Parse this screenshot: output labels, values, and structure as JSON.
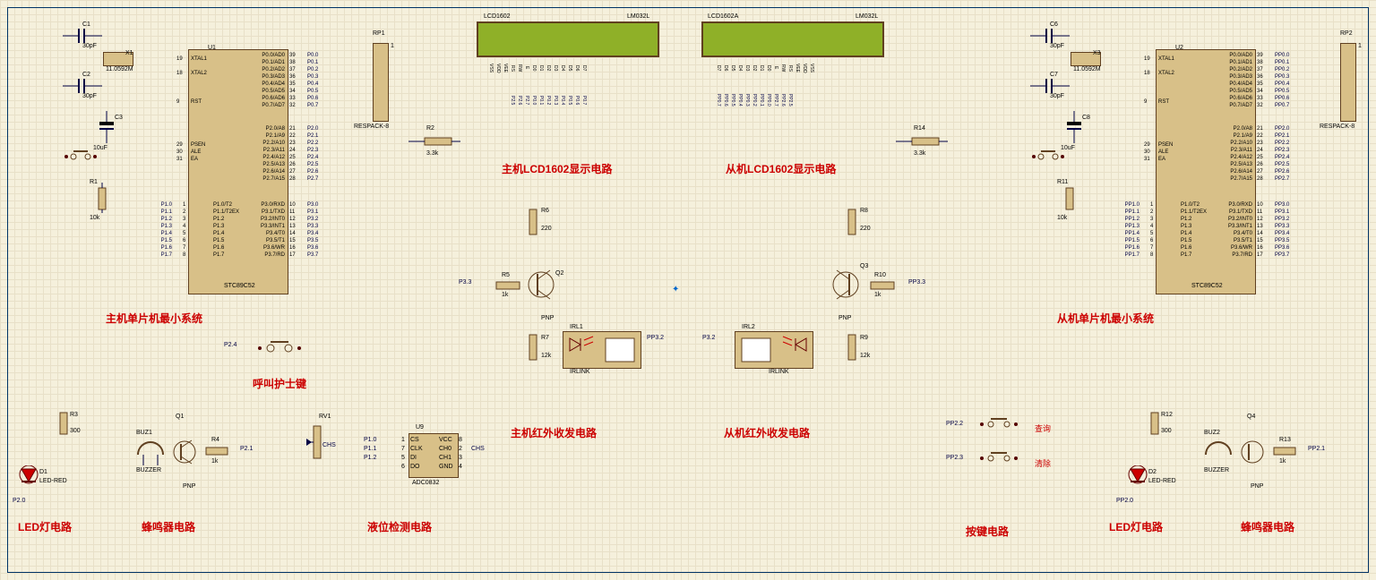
{
  "center_mark": "✦",
  "titles": {
    "master_mcu": "主机单片机最小系统",
    "slave_mcu": "从机单片机最小系统",
    "master_lcd": "主机LCD1602显示电路",
    "slave_lcd": "从机LCD1602显示电路",
    "master_ir": "主机红外收发电路",
    "slave_ir": "从机红外收发电路",
    "led_ckt_l": "LED灯电路",
    "buzzer_ckt_l": "蜂鸣器电路",
    "level_ckt": "液位检测电路",
    "nurse_key": "呼叫护士键",
    "key_ckt": "按键电路",
    "led_ckt_r": "LED灯电路",
    "buzzer_ckt_r": "蜂鸣器电路",
    "query": "查询",
    "clear": "清除"
  },
  "parts": {
    "U1": {
      "ref": "U1",
      "val": "STC89C52"
    },
    "U2": {
      "ref": "U2",
      "val": "STC89C52"
    },
    "U9": {
      "ref": "U9",
      "val": "ADC0832"
    },
    "X1": {
      "ref": "X1",
      "val": "11.0592M",
      "type": "CRYSTAL"
    },
    "X3": {
      "ref": "X3",
      "val": "11.0592M",
      "type": "CRYSTAL"
    },
    "C1": {
      "ref": "C1",
      "val": "30pF"
    },
    "C2": {
      "ref": "C2",
      "val": "30pF"
    },
    "C3": {
      "ref": "C3",
      "val": "10uF"
    },
    "C6": {
      "ref": "C6",
      "val": "30pF"
    },
    "C7": {
      "ref": "C7",
      "val": "30pF"
    },
    "C8": {
      "ref": "C8",
      "val": "10uF"
    },
    "R1": {
      "ref": "R1",
      "val": "10k"
    },
    "R2": {
      "ref": "R2",
      "val": "3.3k"
    },
    "R3": {
      "ref": "R3",
      "val": "300"
    },
    "R4": {
      "ref": "R4",
      "val": "1k"
    },
    "R5": {
      "ref": "R5",
      "val": "1k"
    },
    "R6": {
      "ref": "R6",
      "val": "220"
    },
    "R7": {
      "ref": "R7",
      "val": "12k"
    },
    "R8": {
      "ref": "R8",
      "val": "220"
    },
    "R9": {
      "ref": "R9",
      "val": "12k"
    },
    "R10": {
      "ref": "R10",
      "val": "1k"
    },
    "R11": {
      "ref": "R11",
      "val": "10k"
    },
    "R12": {
      "ref": "R12",
      "val": "300"
    },
    "R13": {
      "ref": "R13",
      "val": "1k"
    },
    "R14": {
      "ref": "R14",
      "val": "3.3k"
    },
    "RP1": {
      "ref": "RP1",
      "val": "RESPACK-8"
    },
    "RP2": {
      "ref": "RP2",
      "val": "RESPACK-8"
    },
    "RV1": {
      "ref": "RV1",
      "val": ""
    },
    "D1": {
      "ref": "D1",
      "val": "LED-RED"
    },
    "D2": {
      "ref": "D2",
      "val": "LED-RED"
    },
    "Q1": {
      "ref": "Q1",
      "val": "PNP"
    },
    "Q2": {
      "ref": "Q2",
      "val": "PNP"
    },
    "Q3": {
      "ref": "Q3",
      "val": "PNP"
    },
    "Q4": {
      "ref": "Q4",
      "val": "PNP"
    },
    "BUZ1": {
      "ref": "BUZ1",
      "val": "BUZZER"
    },
    "BUZ2": {
      "ref": "BUZ2",
      "val": "BUZZER"
    },
    "IRL1": {
      "ref": "IRL1",
      "val": "IRLINK"
    },
    "IRL2": {
      "ref": "IRL2",
      "val": "IRLINK"
    },
    "LCD1": {
      "ref": "LCD1602",
      "val": "LM032L"
    },
    "LCD2": {
      "ref": "LCD1602A",
      "val": "LM032L"
    }
  },
  "nets": {
    "P3_3": "P3.3",
    "PP3_3": "PP3.3",
    "PP3_2": "PP3.2",
    "P3_2": "P3.2",
    "P2_0": "P2.0",
    "P2_1": "P2.1",
    "P2_4": "P2.4",
    "P1_0": "P1.0",
    "P1_1": "P1.1",
    "P1_2": "P1.2",
    "PP2_0": "PP2.0",
    "PP2_1": "PP2.1",
    "PP2_2": "PP2.2",
    "PP2_3": "PP2.3"
  },
  "mcu_pins_left_upper": [
    "XTAL1",
    "XTAL2",
    "RST",
    "PSEN",
    "ALE",
    "EA"
  ],
  "mcu_pins_left_nums": [
    "19",
    "18",
    "9",
    "29",
    "30",
    "31"
  ],
  "mcu_pins_right_p0": [
    "P0.0/AD0",
    "P0.1/AD1",
    "P0.2/AD2",
    "P0.3/AD3",
    "P0.4/AD4",
    "P0.5/AD5",
    "P0.6/AD6",
    "P0.7/AD7"
  ],
  "mcu_pins_right_p0_nums": [
    "39",
    "38",
    "37",
    "36",
    "35",
    "34",
    "33",
    "32"
  ],
  "mcu_pins_right_p0_nets": [
    "P0.0",
    "P0.1",
    "P0.2",
    "P0.3",
    "P0.4",
    "P0.5",
    "P0.6",
    "P0.7"
  ],
  "mcu_pins_right_pp0_nets": [
    "PP0.0",
    "PP0.1",
    "PP0.2",
    "PP0.3",
    "PP0.4",
    "PP0.5",
    "PP0.6",
    "PP0.7"
  ],
  "mcu_pins_right_p2": [
    "P2.0/A8",
    "P2.1/A9",
    "P2.2/A10",
    "P2.3/A11",
    "P2.4/A12",
    "P2.5/A13",
    "P2.6/A14",
    "P2.7/A15"
  ],
  "mcu_pins_right_p2_nums": [
    "21",
    "22",
    "23",
    "24",
    "25",
    "26",
    "27",
    "28"
  ],
  "mcu_pins_right_p2_nets": [
    "P2.0",
    "P2.1",
    "P2.2",
    "P2.3",
    "P2.4",
    "P2.5",
    "P2.6",
    "P2.7"
  ],
  "mcu_pins_right_pp2_nets": [
    "PP2.0",
    "PP2.1",
    "PP2.2",
    "PP2.3",
    "PP2.4",
    "PP2.5",
    "PP2.6",
    "PP2.7"
  ],
  "mcu_p1_row": [
    "P1.0/T2",
    "P1.1/T2EX",
    "P1.2",
    "P1.3",
    "P1.4",
    "P1.5",
    "P1.6",
    "P1.7"
  ],
  "mcu_p1_nums": [
    "1",
    "2",
    "3",
    "4",
    "5",
    "6",
    "7",
    "8"
  ],
  "mcu_p1_nets": [
    "P1.0",
    "P1.1",
    "P1.2",
    "P1.3",
    "P1.4",
    "P1.5",
    "P1.6",
    "P1.7"
  ],
  "mcu_pp1_nets": [
    "PP1.0",
    "PP1.1",
    "PP1.2",
    "PP1.3",
    "PP1.4",
    "PP1.5",
    "PP1.6",
    "PP1.7"
  ],
  "mcu_p3_row": [
    "P3.0/RXD",
    "P3.1/TXD",
    "P3.2/INT0",
    "P3.3/INT1",
    "P3.4/T0",
    "P3.5/T1",
    "P3.6/WR",
    "P3.7/RD"
  ],
  "mcu_p3_nums": [
    "10",
    "11",
    "12",
    "13",
    "14",
    "15",
    "16",
    "17"
  ],
  "mcu_p3_nets": [
    "P3.0",
    "P3.1",
    "P3.2",
    "P3.3",
    "P3.4",
    "P3.5",
    "P3.6",
    "P3.7"
  ],
  "mcu_pp3_nets": [
    "PP3.0",
    "PP3.1",
    "PP3.2",
    "PP3.3",
    "PP3.4",
    "PP3.5",
    "PP3.6",
    "PP3.7"
  ],
  "lcd_pins_l": [
    "VSS",
    "VDD",
    "VEE",
    "RS",
    "RW",
    "E",
    "D0",
    "D1",
    "D2",
    "D3",
    "D4",
    "D5",
    "D6",
    "D7"
  ],
  "lcd_pins_r": [
    "D7",
    "D6",
    "D5",
    "D4",
    "D3",
    "D2",
    "D1",
    "D0",
    "E",
    "RW",
    "RS",
    "VEE",
    "VDD",
    "VSS"
  ],
  "lcd_nets_l": [
    "",
    "",
    "",
    "P2.5",
    "P2.6",
    "P2.7",
    "P0.0",
    "P0.1",
    "P0.2",
    "P0.3",
    "P0.4",
    "P0.5",
    "P0.6",
    "P0.7"
  ],
  "lcd_nets_r": [
    "PP0.7",
    "PP0.6",
    "PP0.5",
    "PP0.4",
    "PP0.3",
    "PP0.2",
    "PP0.1",
    "PP0.0",
    "PP2.7",
    "PP2.6",
    "PP2.5",
    "",
    "",
    ""
  ],
  "adc_pins": {
    "CS": "CS",
    "CLK": "CLK",
    "DI": "DI",
    "DO": "DO",
    "VCC": "VCC",
    "CH0": "CH0",
    "CH1": "CH1",
    "GND": "GND",
    "n1": "1",
    "n2": "2",
    "n3": "3",
    "n4": "4",
    "n5": "5",
    "n6": "6",
    "n7": "7",
    "n8": "8",
    "CHS": "CHS"
  },
  "rp_pin1": "1"
}
